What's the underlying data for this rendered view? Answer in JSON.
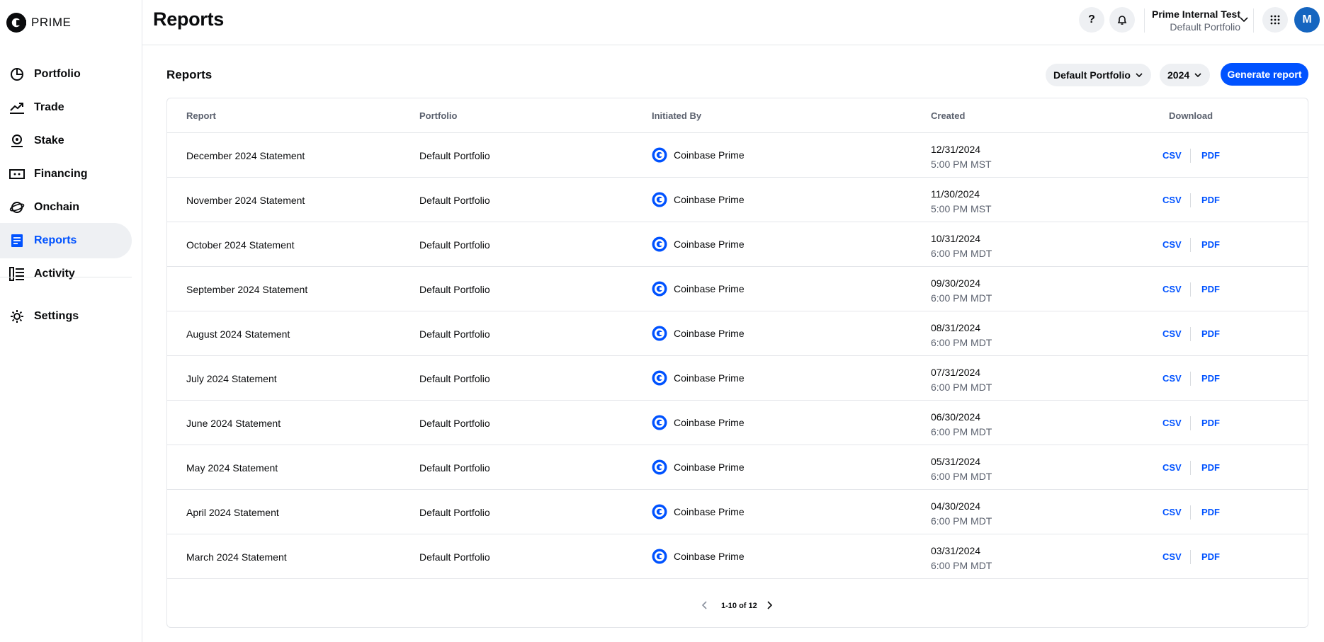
{
  "app": {
    "logo_text": "PRIME",
    "accent": "#0052ff"
  },
  "sidebar": {
    "items": [
      {
        "label": "Portfolio",
        "icon": "pie-chart-icon"
      },
      {
        "label": "Trade",
        "icon": "trend-line-icon"
      },
      {
        "label": "Stake",
        "icon": "stake-icon"
      },
      {
        "label": "Financing",
        "icon": "financing-icon"
      },
      {
        "label": "Onchain",
        "icon": "orbit-icon"
      },
      {
        "label": "Reports",
        "icon": "document-icon",
        "active": true
      },
      {
        "label": "Activity",
        "icon": "activity-list-icon"
      },
      {
        "label": "Settings",
        "icon": "gear-icon"
      }
    ]
  },
  "header": {
    "title": "Reports",
    "help_icon": "?",
    "account_name": "Prime Internal Test",
    "account_portfolio": "Default Portfolio",
    "avatar_initial": "M"
  },
  "main": {
    "section_title": "Reports",
    "portfolio_filter": "Default Portfolio",
    "year_filter": "2024",
    "generate_label": "Generate report"
  },
  "table": {
    "columns": [
      "Report",
      "Portfolio",
      "Initiated By",
      "Created",
      "Download"
    ],
    "rows": [
      {
        "report": "December 2024 Statement",
        "portfolio": "Default Portfolio",
        "initiated_by": "Coinbase Prime",
        "date": "12/31/2024",
        "time": "5:00 PM MST",
        "csv": "CSV",
        "pdf": "PDF"
      },
      {
        "report": "November 2024 Statement",
        "portfolio": "Default Portfolio",
        "initiated_by": "Coinbase Prime",
        "date": "11/30/2024",
        "time": "5:00 PM MST",
        "csv": "CSV",
        "pdf": "PDF"
      },
      {
        "report": "October 2024 Statement",
        "portfolio": "Default Portfolio",
        "initiated_by": "Coinbase Prime",
        "date": "10/31/2024",
        "time": "6:00 PM MDT",
        "csv": "CSV",
        "pdf": "PDF"
      },
      {
        "report": "September 2024 Statement",
        "portfolio": "Default Portfolio",
        "initiated_by": "Coinbase Prime",
        "date": "09/30/2024",
        "time": "6:00 PM MDT",
        "csv": "CSV",
        "pdf": "PDF"
      },
      {
        "report": "August 2024 Statement",
        "portfolio": "Default Portfolio",
        "initiated_by": "Coinbase Prime",
        "date": "08/31/2024",
        "time": "6:00 PM MDT",
        "csv": "CSV",
        "pdf": "PDF"
      },
      {
        "report": "July 2024 Statement",
        "portfolio": "Default Portfolio",
        "initiated_by": "Coinbase Prime",
        "date": "07/31/2024",
        "time": "6:00 PM MDT",
        "csv": "CSV",
        "pdf": "PDF"
      },
      {
        "report": "June 2024 Statement",
        "portfolio": "Default Portfolio",
        "initiated_by": "Coinbase Prime",
        "date": "06/30/2024",
        "time": "6:00 PM MDT",
        "csv": "CSV",
        "pdf": "PDF"
      },
      {
        "report": "May 2024 Statement",
        "portfolio": "Default Portfolio",
        "initiated_by": "Coinbase Prime",
        "date": "05/31/2024",
        "time": "6:00 PM MDT",
        "csv": "CSV",
        "pdf": "PDF"
      },
      {
        "report": "April 2024 Statement",
        "portfolio": "Default Portfolio",
        "initiated_by": "Coinbase Prime",
        "date": "04/30/2024",
        "time": "6:00 PM MDT",
        "csv": "CSV",
        "pdf": "PDF"
      },
      {
        "report": "March 2024 Statement",
        "portfolio": "Default Portfolio",
        "initiated_by": "Coinbase Prime",
        "date": "03/31/2024",
        "time": "6:00 PM MDT",
        "csv": "CSV",
        "pdf": "PDF"
      }
    ]
  },
  "pagination": {
    "text": "1-10 of 12"
  }
}
